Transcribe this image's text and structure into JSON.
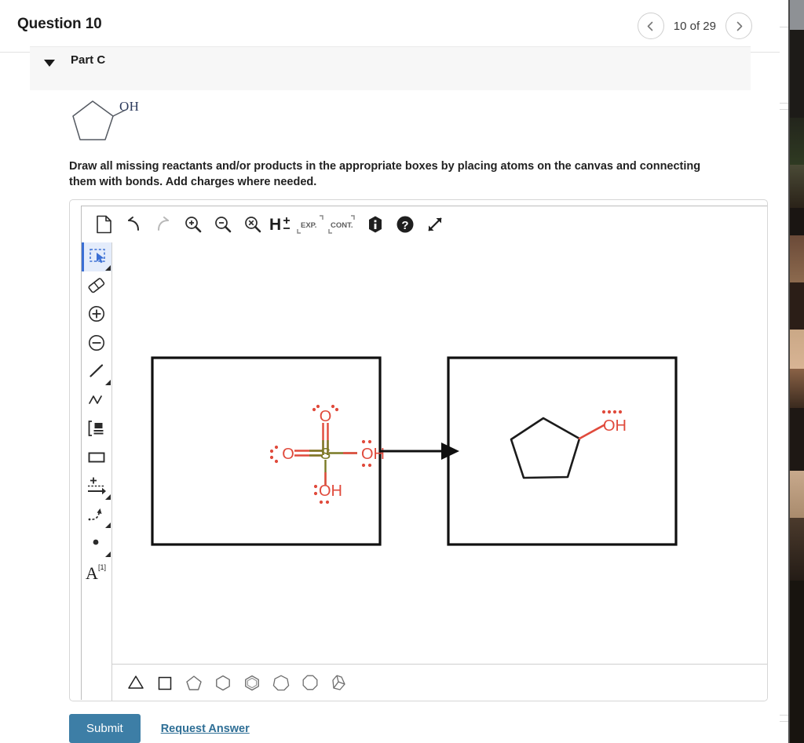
{
  "header": {
    "question_title": "Question 10",
    "pager_label": "10 of 29",
    "prev_icon": "chevron-left-icon",
    "next_icon": "chevron-right-icon"
  },
  "part": {
    "label": "Part C",
    "caret_icon": "caret-down-icon"
  },
  "prompt": {
    "structure_name": "cyclopentanol",
    "oh_label": "OH"
  },
  "instructions": {
    "text": "Draw all missing reactants and/or products in the appropriate boxes by placing atoms on the canvas and connecting them with bonds. Add charges where needed."
  },
  "editor": {
    "top_toolbar": [
      {
        "name": "new-document-button",
        "icon": "new-document-icon",
        "label": "",
        "disabled": false
      },
      {
        "name": "undo-button",
        "icon": "undo-icon",
        "label": "",
        "disabled": false
      },
      {
        "name": "redo-button",
        "icon": "redo-icon",
        "label": "",
        "disabled": true
      },
      {
        "name": "zoom-in-button",
        "icon": "zoom-in-icon",
        "label": "",
        "disabled": false
      },
      {
        "name": "zoom-out-button",
        "icon": "zoom-out-icon",
        "label": "",
        "disabled": false
      },
      {
        "name": "zoom-reset-button",
        "icon": "zoom-reset-icon",
        "label": "",
        "disabled": false
      },
      {
        "name": "hydrogen-toggle-button",
        "icon": "h-plus-minus-icon",
        "label": "H",
        "disabled": false
      },
      {
        "name": "expand-structure-button",
        "icon": "expand-brackets-icon",
        "label": "EXP.",
        "disabled": false
      },
      {
        "name": "contract-structure-button",
        "icon": "contract-brackets-icon",
        "label": "CONT.",
        "disabled": false
      },
      {
        "name": "info-button",
        "icon": "info-icon",
        "label": "",
        "disabled": false
      },
      {
        "name": "help-button",
        "icon": "question-mark-icon",
        "label": "",
        "disabled": false
      },
      {
        "name": "fullscreen-button",
        "icon": "fullscreen-arrows-icon",
        "label": "",
        "disabled": false
      }
    ],
    "left_tools": [
      {
        "name": "tool-select",
        "icon": "marquee-select-icon",
        "selected": true,
        "has_submenu": true
      },
      {
        "name": "tool-eraser",
        "icon": "eraser-icon",
        "selected": false,
        "has_submenu": false
      },
      {
        "name": "tool-increase-charge",
        "icon": "plus-circle-icon",
        "selected": false,
        "has_submenu": false
      },
      {
        "name": "tool-decrease-charge",
        "icon": "minus-circle-icon",
        "selected": false,
        "has_submenu": false
      },
      {
        "name": "tool-single-bond",
        "icon": "single-bond-icon",
        "selected": false,
        "has_submenu": true
      },
      {
        "name": "tool-chain",
        "icon": "zigzag-chain-icon",
        "selected": false,
        "has_submenu": false
      },
      {
        "name": "tool-bracket",
        "icon": "bracket-group-icon",
        "selected": false,
        "has_submenu": false
      },
      {
        "name": "tool-rectangle-box",
        "icon": "rectangle-icon",
        "selected": false,
        "has_submenu": false
      },
      {
        "name": "tool-reaction-arrow",
        "icon": "reaction-arrow-icon",
        "selected": false,
        "has_submenu": true
      },
      {
        "name": "tool-curved-arrow",
        "icon": "curved-arrow-icon",
        "selected": false,
        "has_submenu": true
      },
      {
        "name": "tool-lone-pair",
        "icon": "dot-lone-pair-icon",
        "selected": false,
        "has_submenu": true
      },
      {
        "name": "tool-atom-label",
        "icon": "atom-label-a-icon",
        "selected": false,
        "has_submenu": false,
        "superscript": "[1]"
      }
    ],
    "templates": [
      {
        "name": "template-cyclopropane",
        "icon": "triangle-icon",
        "sides": 3
      },
      {
        "name": "template-cyclobutane",
        "icon": "square-icon",
        "sides": 4
      },
      {
        "name": "template-cyclopentane",
        "icon": "pentagon-icon",
        "sides": 5
      },
      {
        "name": "template-cyclohexane",
        "icon": "hexagon-icon",
        "sides": 6
      },
      {
        "name": "template-benzene",
        "icon": "benzene-ring-icon",
        "sides": 6
      },
      {
        "name": "template-cycloheptane",
        "icon": "heptagon-icon",
        "sides": 7
      },
      {
        "name": "template-cyclooctane",
        "icon": "octagon-icon",
        "sides": 8
      },
      {
        "name": "template-bicyclic",
        "icon": "bicyclic-icon",
        "sides": 0
      }
    ],
    "canvas": {
      "reactant_box": {
        "name": "reactant-box",
        "molecule": "sulfuric acid",
        "atoms": {
          "center": "S",
          "top": "O",
          "left": "O",
          "right": "OH",
          "bottom": "OH"
        }
      },
      "arrow": {
        "name": "reaction-arrow",
        "direction": "right"
      },
      "product_box": {
        "name": "product-box",
        "molecule": "cyclopentanol",
        "oh_label": "OH"
      }
    }
  },
  "footer": {
    "submit_label": "Submit",
    "request_answer_label": "Request Answer"
  },
  "colors": {
    "accent_blue": "#3d7ea6",
    "link_blue": "#2f6f96",
    "oxygen_red": "#e04a3c",
    "sulfur_olive": "#7a7a26",
    "selected_tool_bg": "#e4ecfb",
    "selected_tool_border": "#3b6fd4",
    "part_bar_bg": "#f7f7f7"
  }
}
